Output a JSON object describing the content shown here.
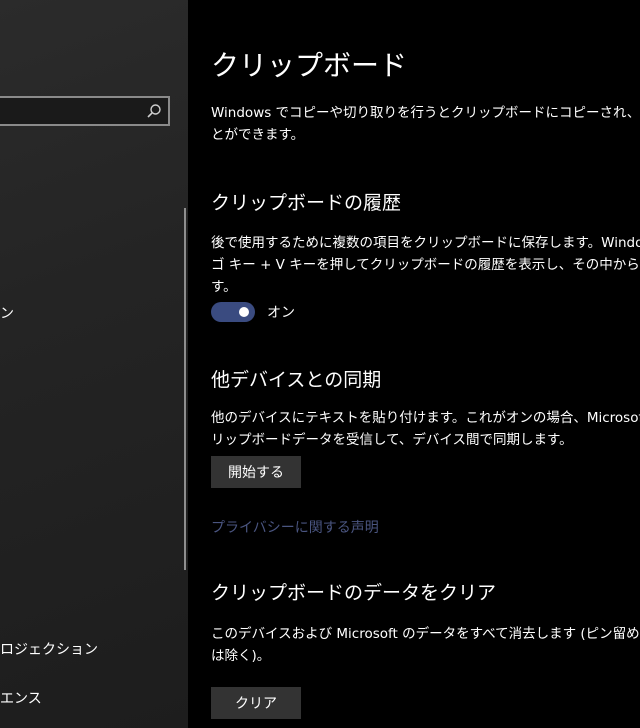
{
  "sidebar": {
    "search": {
      "placeholder": "",
      "icon": "search-icon"
    },
    "items": [
      {
        "label": "ン"
      },
      {
        "label": "ロジェクション"
      },
      {
        "label": "エンス"
      }
    ]
  },
  "main": {
    "title": "クリップボード",
    "intro": "Windows でコピーや切り取りを行うとクリップボードにコピーされ、貼り付ける\nとができます。",
    "history": {
      "heading": "クリップボードの履歴",
      "description": "後で使用するために複数の項目をクリップボードに保存します。Windows\nゴ キー + V キーを押してクリップボードの履歴を表示し、その中から貼り付け\nす。",
      "toggle_state": "オン",
      "toggle_on": true
    },
    "sync": {
      "heading": "他デバイスとの同期",
      "description": "他のデバイスにテキストを貼り付けます。これがオンの場合、Microsoft はク\nリップボードデータを受信して、デバイス間で同期します。",
      "button_label": "開始する"
    },
    "privacy_link": "プライバシーに関する声明",
    "clear": {
      "heading": "クリップボードのデータをクリア",
      "description": "このデバイスおよび Microsoft のデータをすべて消去します (ピン留めした項\nは除く)。",
      "button_label": "クリア"
    }
  },
  "colors": {
    "background": "#000000",
    "sidebar": "#262626",
    "toggle_on": "#3a4b80",
    "button": "#333333",
    "link": "#4a5580"
  }
}
